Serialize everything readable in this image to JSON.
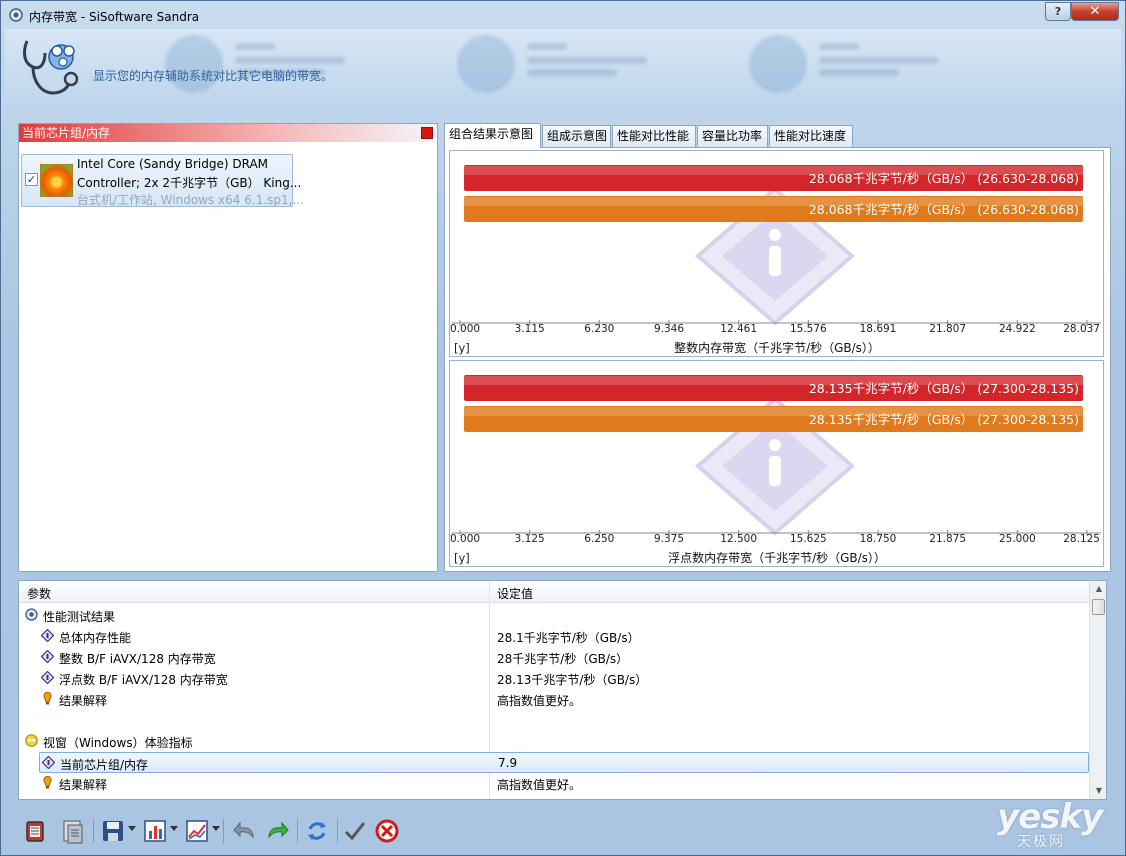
{
  "window": {
    "title": "内存带宽 - SiSoftware Sandra",
    "help_label": "?",
    "close_label": "✕"
  },
  "header": {
    "description": "显示您的内存辅助系统对比其它电脑的带宽。",
    "icon": "stethoscope-brain-icon"
  },
  "left_panel": {
    "title": "当前芯片组/内存",
    "item": {
      "checked": true,
      "line1": "Intel Core (Sandy Bridge) DRAM",
      "line2": "Controller; 2x 2千兆字节（GB） King...",
      "line3": "台式机/工作站, Windows x64 6.1.sp1,..."
    }
  },
  "tabs": [
    {
      "label": "组合结果示意图",
      "active": true
    },
    {
      "label": "组成示意图",
      "active": false
    },
    {
      "label": "性能对比性能",
      "active": false
    },
    {
      "label": "容量比功率",
      "active": false
    },
    {
      "label": "性能对比速度",
      "active": false
    }
  ],
  "chart_data": [
    {
      "type": "bar",
      "orientation": "horizontal",
      "xlabel": "整数内存带宽（千兆字节/秒（GB/s））",
      "y_axis_label": "[y]",
      "xlim": [
        0,
        28.037
      ],
      "ticks": [
        "0.000",
        "3.115",
        "6.230",
        "9.346",
        "12.461",
        "15.576",
        "18.691",
        "21.807",
        "24.922",
        "28.037"
      ],
      "series": [
        {
          "value": 28.068,
          "label": "28.068千兆字节/秒（GB/s） (26.630-28.068)",
          "color": "#d4262a"
        },
        {
          "value": 28.068,
          "label": "28.068千兆字节/秒（GB/s） (26.630-28.068)",
          "color": "#e07a1c"
        }
      ]
    },
    {
      "type": "bar",
      "orientation": "horizontal",
      "xlabel": "浮点数内存带宽（千兆字节/秒（GB/s））",
      "y_axis_label": "[y]",
      "xlim": [
        0,
        28.125
      ],
      "ticks": [
        "0.000",
        "3.125",
        "6.250",
        "9.375",
        "12.500",
        "15.625",
        "18.750",
        "21.875",
        "25.000",
        "28.125"
      ],
      "series": [
        {
          "value": 28.135,
          "label": "28.135千兆字节/秒（GB/s） (27.300-28.135)",
          "color": "#d4262a"
        },
        {
          "value": 28.135,
          "label": "28.135千兆字节/秒（GB/s） (27.300-28.135)",
          "color": "#e07a1c"
        }
      ]
    }
  ],
  "grid": {
    "col_param": "参数",
    "col_value": "设定值",
    "rows": [
      {
        "level": 0,
        "icon": "globe-icon",
        "name": "性能测试结果",
        "value": ""
      },
      {
        "level": 1,
        "icon": "diamond-icon",
        "name": "总体内存性能",
        "value": "28.1千兆字节/秒（GB/s）"
      },
      {
        "level": 1,
        "icon": "diamond-icon",
        "name": "整数 B/F iAVX/128 内存带宽",
        "value": "28千兆字节/秒（GB/s）"
      },
      {
        "level": 1,
        "icon": "diamond-icon",
        "name": "浮点数 B/F iAVX/128 内存带宽",
        "value": "28.13千兆字节/秒（GB/s）"
      },
      {
        "level": 1,
        "icon": "tip-icon",
        "name": "结果解释",
        "value": "高指数值更好。"
      },
      {
        "level": 0,
        "icon": "windows-icon",
        "name": "视窗（Windows）体验指标",
        "value": ""
      },
      {
        "level": 1,
        "icon": "diamond-icon",
        "name": "当前芯片组/内存",
        "value": "7.9",
        "selected": true
      },
      {
        "level": 1,
        "icon": "tip-icon",
        "name": "结果解释",
        "value": "高指数值更好。"
      }
    ]
  },
  "toolbar": {
    "buttons": [
      "module-icon",
      "report-icon",
      "save-icon",
      "chart-icon",
      "graph-icon",
      "undo-icon",
      "redo-icon",
      "refresh-icon",
      "ok-icon",
      "cancel-icon"
    ]
  },
  "watermark": {
    "main": "yesky",
    "sub": "天极网"
  }
}
